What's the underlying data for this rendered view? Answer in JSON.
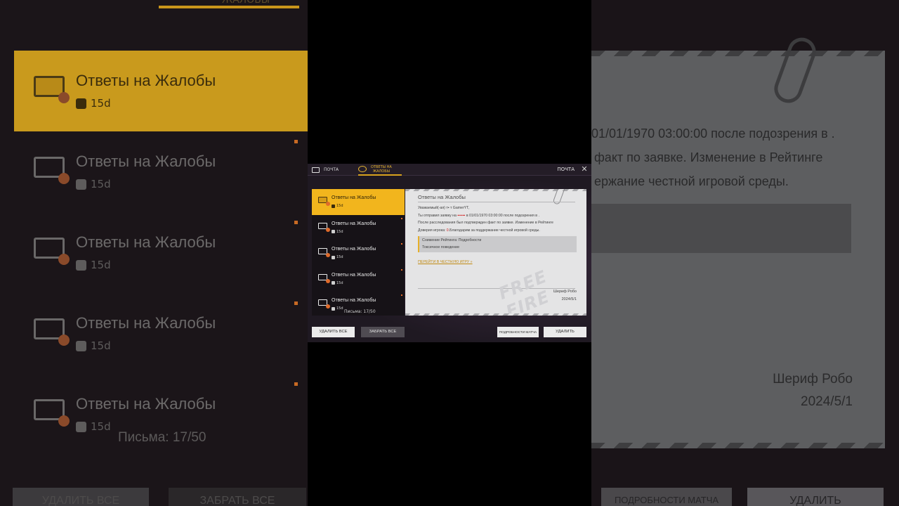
{
  "window": {
    "tab_mail_label": "ПОЧТА",
    "tab_complaints_label_line1": "ОТВЕТЫ НА",
    "tab_complaints_label_line2": "ЖАЛОБЫ",
    "title": "ПОЧТА"
  },
  "list": {
    "items": [
      {
        "title": "Ответы на Жалобы",
        "age": "15d",
        "active": true
      },
      {
        "title": "Ответы на Жалобы",
        "age": "15d",
        "active": false
      },
      {
        "title": "Ответы на Жалобы",
        "age": "15d",
        "active": false
      },
      {
        "title": "Ответы на Жалобы",
        "age": "15d",
        "active": false
      },
      {
        "title": "Ответы на Жалобы",
        "age": "15d",
        "active": false
      }
    ],
    "letters_count": "Письма: 17/50"
  },
  "letter": {
    "heading": "Ответы на Жалобы",
    "greeting": "Уважаемый(-ая) т▪ т     GamerYT,",
    "line1_prefix": "Ты отправил заявку на ",
    "line1_red": "▪▪▪▪▪▪",
    "line1_suffix": " в 01/01/1970 03:00:00 после подозрения в .",
    "line2": "После расследования был подтвержден факт по заявке. Изменение в Рейтинге",
    "line3_prefix": "Доверия игрока: ",
    "line3_red": "0",
    "line3_suffix": ".Благодарим за поддержание честной игровой среды.",
    "detail_title": "Снижение Рейтинга: Подробности",
    "detail_reason": "Токсичное поведение",
    "link": "ПЕРЕЙТИ В ЧЕСТНУЮ ИГРУ »",
    "signature": "Шериф Робо",
    "date": "2024/5/1"
  },
  "buttons": {
    "delete_all": "УДАЛИТЬ ВСЕ",
    "take_all": "ЗАБРАТЬ ВСЕ",
    "match_details": "ПОДРОБНОСТИ МАТЧА",
    "delete": "УДАЛИТЬ"
  },
  "backdrop": {
    "tab_label": "ЖАЛОБЫ",
    "items": [
      {
        "title": "Ответы на Жалобы",
        "age": "15d"
      },
      {
        "title": "Ответы на Жалобы",
        "age": "15d"
      },
      {
        "title": "Ответы на Жалобы",
        "age": "15d"
      },
      {
        "title": "Ответы на Жалобы",
        "age": "15d"
      },
      {
        "title": "Ответы на Жалобы",
        "age": "15d"
      }
    ],
    "letters_count": "Письма: 17/50",
    "left_btn1": "УДАЛИТЬ ВСЕ",
    "left_btn2": "ЗАБРАТЬ ВСЕ",
    "text_line1": "01/01/1970 03:00:00 после подозрения в .",
    "text_line2": "факт по заявке. Изменение в Рейтинге",
    "text_line3": "ержание честной игровой среды.",
    "signature": "Шериф Робо",
    "date": "2024/5/1",
    "right_btn1": "ПОДРОБНОСТИ МАТЧА",
    "right_btn2": "УДАЛИТЬ"
  },
  "watermark": "FREE FIRE"
}
